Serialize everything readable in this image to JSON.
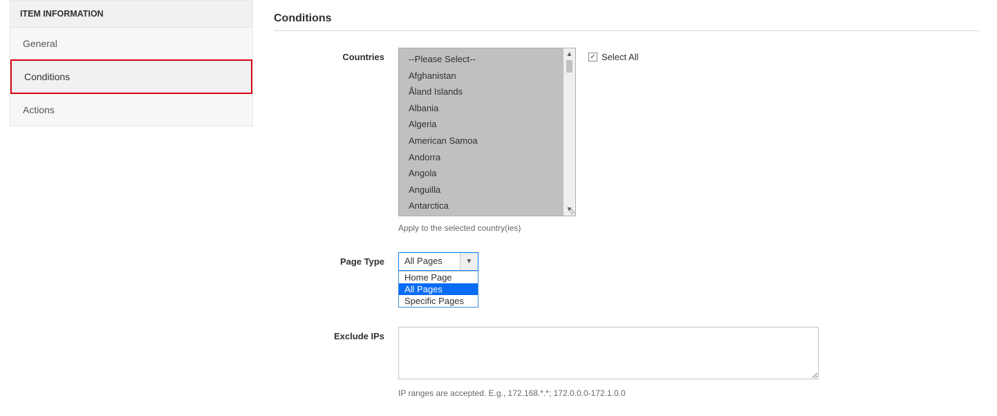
{
  "sidebar": {
    "header": "ITEM INFORMATION",
    "items": [
      {
        "label": "General",
        "active": false
      },
      {
        "label": "Conditions",
        "active": true
      },
      {
        "label": "Actions",
        "active": false
      }
    ]
  },
  "section": {
    "title": "Conditions"
  },
  "countries": {
    "label": "Countries",
    "options": [
      "--Please Select--",
      "Afghanistan",
      "Åland Islands",
      "Albania",
      "Algeria",
      "American Samoa",
      "Andorra",
      "Angola",
      "Anguilla",
      "Antarctica"
    ],
    "help": "Apply to the selected country(ies)",
    "select_all_label": "Select All",
    "select_all_checked": true
  },
  "page_type": {
    "label": "Page Type",
    "selected": "All Pages",
    "options": [
      {
        "label": "Home Page",
        "selected": false
      },
      {
        "label": "All Pages",
        "selected": true
      },
      {
        "label": "Specific Pages",
        "selected": false
      }
    ]
  },
  "exclude_ips": {
    "label": "Exclude IPs",
    "value": "",
    "help": "IP ranges are accepted. E.g., 172.168.*.*; 172.0.0.0-172.1.0.0"
  }
}
